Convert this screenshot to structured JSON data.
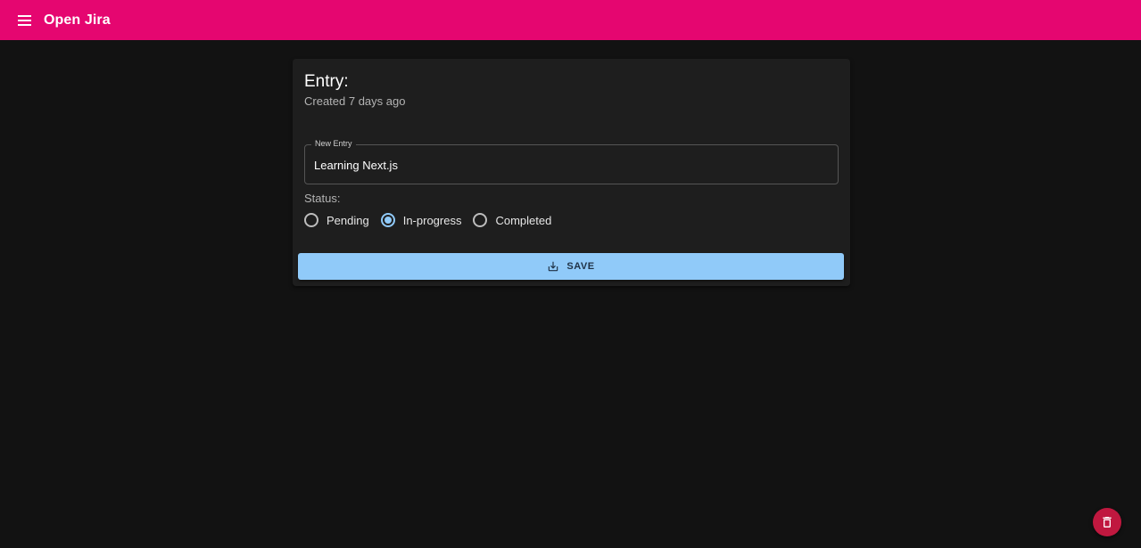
{
  "appbar": {
    "menu_icon": "menu-icon",
    "title": "Open Jira",
    "color": "#e50670"
  },
  "entry": {
    "title": "Entry:",
    "subtitle": "Created 7 days ago",
    "field": {
      "label": "New Entry",
      "value": "Learning Next.js"
    },
    "status_label": "Status:",
    "status_options": [
      {
        "label": "Pending",
        "checked": false
      },
      {
        "label": "In-progress",
        "checked": true
      },
      {
        "label": "Completed",
        "checked": false
      }
    ],
    "save_button": {
      "label": "SAVE",
      "icon": "save-alt-icon",
      "color": "#90caf9"
    }
  },
  "delete_fab": {
    "icon": "trash-icon",
    "color": "#c0183f"
  }
}
